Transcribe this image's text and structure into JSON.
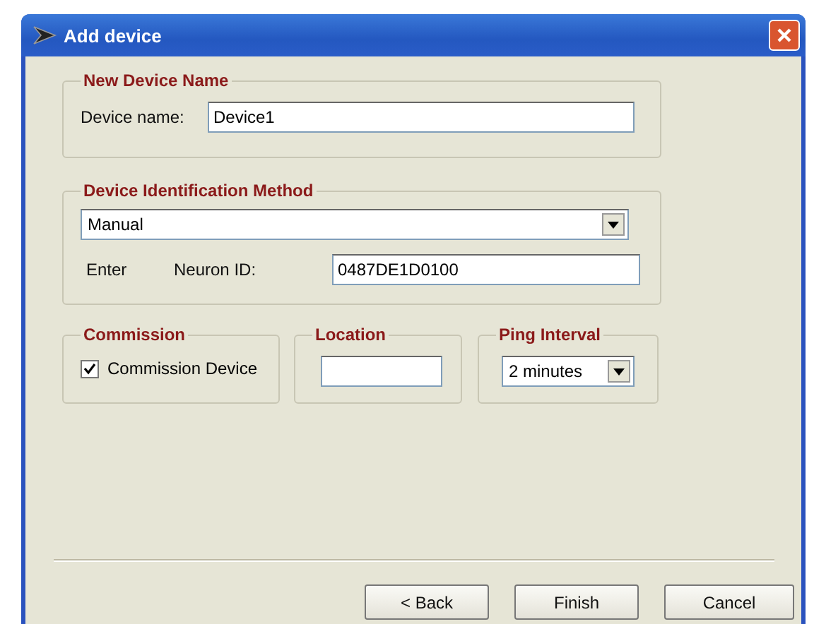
{
  "window": {
    "title": "Add device"
  },
  "new_device_name": {
    "title": "New Device Name",
    "label": "Device name:",
    "value": "Device1"
  },
  "identification": {
    "title": "Device Identification Method",
    "method": "Manual",
    "enter_label": "Enter",
    "id_label": "Neuron ID:",
    "id_value": "0487DE1D0100"
  },
  "commission": {
    "title": "Commission",
    "label": "Commission Device",
    "checked": true
  },
  "location": {
    "title": "Location"
  },
  "ping_interval": {
    "title": "Ping Interval",
    "value": "2 minutes"
  },
  "buttons": [
    {
      "label": "< Back",
      "kind": "back"
    },
    {
      "label": "Finish",
      "kind": "finish"
    },
    {
      "label": "Cancel",
      "kind": "cancel"
    }
  ]
}
